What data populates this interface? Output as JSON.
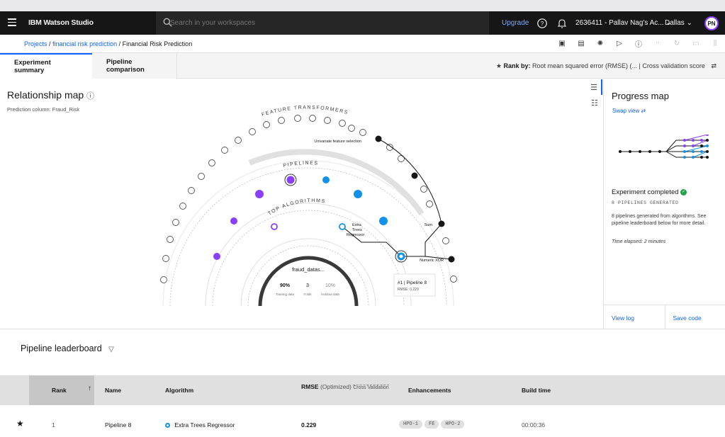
{
  "topbar": {
    "brand_bold": "IBM Watson Studio",
    "search_placeholder": "Search in your workspaces",
    "upgrade": "Upgrade",
    "account": "2636411 - Pallav Nag's Ac...",
    "region": "Dallas",
    "avatar_initials": "PN"
  },
  "breadcrumb": {
    "projects": "Projects",
    "sep": "/",
    "project": "financial risk prediction",
    "current": "Financial Risk Prediction"
  },
  "tabs": {
    "summary": "Experiment summary",
    "comparison": "Pipeline comparison"
  },
  "rankby": {
    "label": "Rank by:",
    "value": "Root mean squared error (RMSE) (...  |  Cross validation score"
  },
  "relmap": {
    "title": "Relationship map",
    "subtitle": "Prediction column: Fraud_Risk",
    "ring_feature": "FEATURE TRANSFORMERS",
    "ring_pipelines": "PIPELINES",
    "ring_algorithms": "TOP ALGORITHMS",
    "label_univariate": "Univariate feature selection",
    "label_sum": "Sum",
    "label_xor": "Numeric XOR",
    "label_extra1": "Extra",
    "label_extra2": "Trees",
    "label_extra3": "Regressor",
    "dataset_name": "fraud_datas...",
    "training_pct": "90%",
    "training_label": "Training data",
    "folds": "3",
    "folds_label": "Folds",
    "holdout_pct": "10%",
    "holdout_label": "Holdout data",
    "tooltip_title": "#1 | Pipeline 8",
    "tooltip_sub": "RMSE: 0.229"
  },
  "progress": {
    "title": "Progress map",
    "swap": "Swap view ⇄",
    "status": "Experiment completed",
    "generated": "8 PIPELINES GENERATED",
    "desc": "8 pipelines generated from algorithms. See pipeline leaderboard below for more detail.",
    "elapsed": "Time elapsed: 2 minutes",
    "view_log": "View log",
    "save_code": "Save code"
  },
  "leaderboard": {
    "title": "Pipeline leaderboard",
    "columns": {
      "rank": "Rank",
      "name": "Name",
      "algorithm": "Algorithm",
      "rmse": "RMSE",
      "rmse_opt": "(Optimized)",
      "rmse_sub": "Cross Validation",
      "enhancements": "Enhancements",
      "build_time": "Build time"
    },
    "rows": [
      {
        "rank": "1",
        "name": "Pipeline 8",
        "algorithm": "Extra Trees Regressor",
        "rmse": "0.229",
        "enh1": "HPO-1",
        "enh2": "FE",
        "enh3": "HPO-2",
        "build_time": "00:00:36"
      }
    ]
  },
  "colors": {
    "accent": "#0f62fe",
    "purple": "#8a3ffc",
    "cyan": "#1192e8",
    "dark": "#161616"
  }
}
